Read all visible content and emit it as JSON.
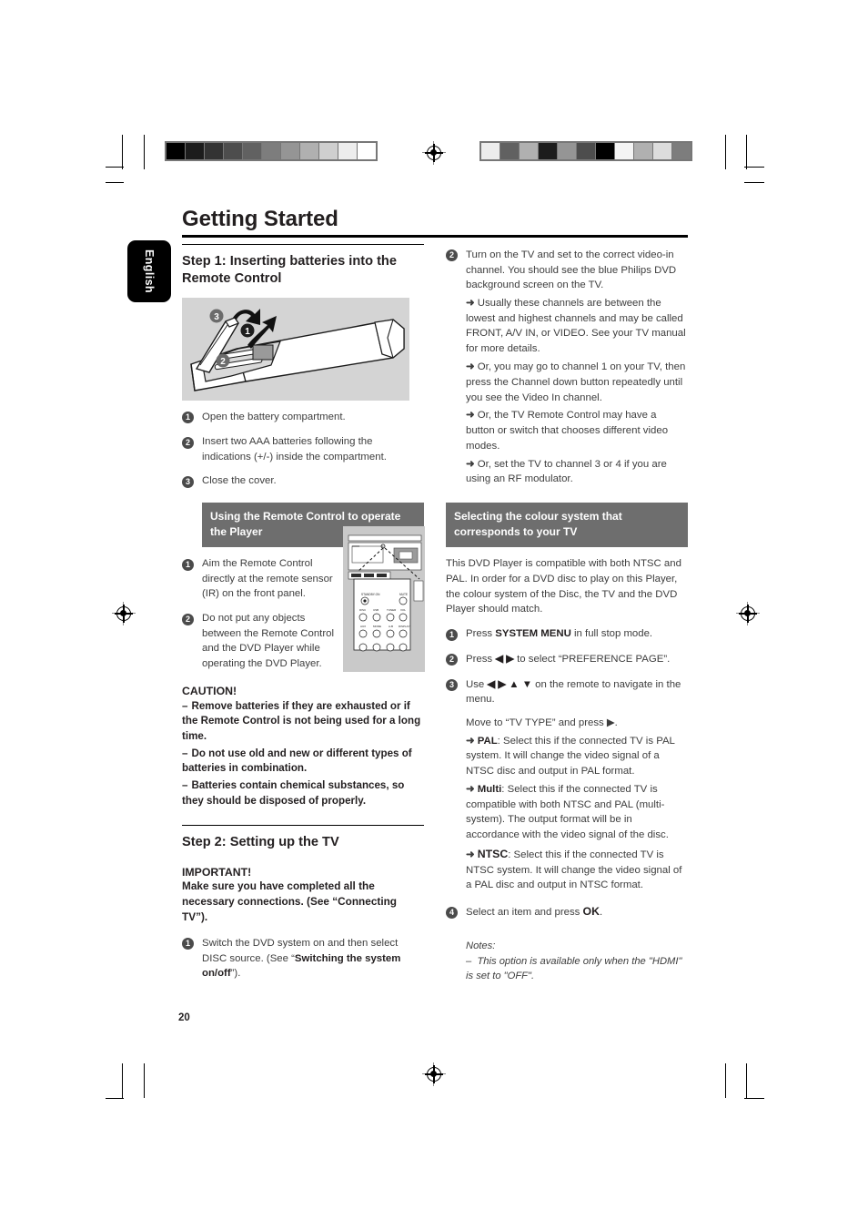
{
  "page": {
    "number": "20",
    "language_tab": "English",
    "title": "Getting Started"
  },
  "calibration": {
    "left_strip_name": "greyscale-calibration-strip-left",
    "left_swatches": [
      "#000000",
      "#1c1c1c",
      "#333333",
      "#4d4d4d",
      "#616161",
      "#7d7d7d",
      "#959595",
      "#b0b0b0",
      "#cfcfcf",
      "#ededed",
      "#ffffff"
    ],
    "right_strip_name": "greyscale-calibration-strip-right",
    "right_swatches": [
      "#ededed",
      "#616161",
      "#b0b0b0",
      "#1c1c1c",
      "#959595",
      "#4d4d4d",
      "#000000",
      "#f4f4f4",
      "#b0b0b0",
      "#dcdcdc",
      "#7d7d7d"
    ]
  },
  "left_column": {
    "step1_heading": "Step 1: Inserting batteries into the Remote Control",
    "figure_remote_caption_numbers": [
      "1",
      "2",
      "3"
    ],
    "steps": [
      {
        "num": "1",
        "text": "Open the battery compartment."
      },
      {
        "num": "2",
        "text": "Insert two AAA batteries following the indications (+/-) inside the compartment."
      },
      {
        "num": "3",
        "text": "Close the cover."
      }
    ],
    "remote_use_heading": "Using the Remote Control to operate the Player",
    "remote_use_steps": [
      {
        "num": "1",
        "text": "Aim the Remote Control directly at the remote sensor (IR) on the front panel."
      },
      {
        "num": "2",
        "text": "Do not put any objects between the Remote Control and the DVD Player while operating the DVD Player."
      }
    ],
    "caution_title": "CAUTION!",
    "caution_items": [
      "Remove batteries if they are exhausted or if the Remote Control is not being used for a long time.",
      "Do not use old and new or different types of batteries in combination.",
      "Batteries contain chemical substances, so they should be disposed of properly."
    ],
    "step2_heading": "Step 2: Setting up the TV",
    "important_title": "IMPORTANT!",
    "important_text": "Make sure you have completed all the necessary connections. (See “Connecting TV”).",
    "step2_item1_num": "1",
    "step2_item1_prefix": "Switch the DVD system on and then select DISC source. (See “",
    "step2_item1_bold": "Switching the system on/off",
    "step2_item1_suffix": "”)."
  },
  "right_column": {
    "step_turn_on_num": "2",
    "step_turn_on_text": "Turn on the TV and set to the correct video-in channel. You should see the blue Philips DVD background screen on the TV.",
    "arrow_items": [
      "Usually these channels are between the lowest and highest channels and may be called FRONT, A/V IN, or VIDEO. See your TV manual for more details.",
      "Or, you may go to channel 1 on your TV, then press the Channel down button repeatedly until you see the Video In channel.",
      "Or, the TV Remote Control may have a button or switch that chooses different video modes.",
      "Or, set the TV to channel 3 or 4 if you are using an RF modulator."
    ],
    "colour_heading": "Selecting the colour system that corresponds to your TV",
    "colour_intro": "This DVD Player is compatible with both NTSC and PAL. In order for a DVD disc to play on this Player, the colour system of the Disc, the TV and the DVD Player should match.",
    "colour_steps": [
      {
        "num": "1",
        "pre": "Press ",
        "bold": "SYSTEM MENU",
        "post": " in full stop mode."
      },
      {
        "num": "2",
        "pre": "Press ",
        "bold": "◀ ▶",
        "post": " to select “PREFERENCE PAGE”."
      },
      {
        "num": "3",
        "pre": "Use ",
        "bold": "◀ ▶ ▲ ▼",
        "post": " on the remote to navigate in the menu."
      }
    ],
    "move_to_text": "Move to “TV TYPE” and press ▶.",
    "tv_type_options": [
      {
        "label": "PAL",
        "desc": ": Select this if the connected TV is PAL system. It will change the video signal of a NTSC disc and output in PAL format."
      },
      {
        "label": "Multi",
        "desc": ": Select this if the connected TV is compatible with both NTSC and PAL (multi-system). The output format will be in accordance with the video signal of the disc."
      },
      {
        "label": "NTSC",
        "desc": ": Select this if the connected TV is NTSC system. It will change the video signal of a PAL disc and output in NTSC format."
      }
    ],
    "final_step": {
      "num": "4",
      "pre": "Select an item and press ",
      "bold": "OK",
      "post": "."
    },
    "notes_label": "Notes:",
    "notes_items": [
      "This option is available only when the \"HDMI\" is set to \"OFF\"."
    ]
  }
}
